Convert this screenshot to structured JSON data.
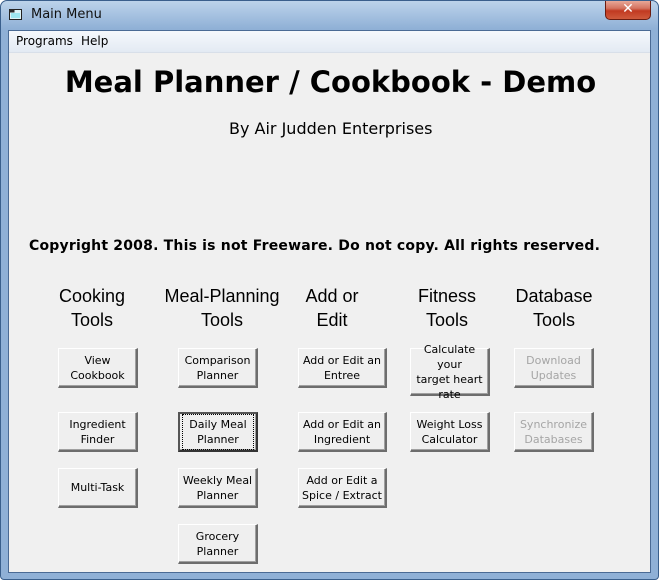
{
  "window": {
    "title": "Main Menu",
    "icon": "app-window-icon",
    "close_label": "✕"
  },
  "menubar": {
    "items": [
      {
        "label": "Programs"
      },
      {
        "label": "Help"
      }
    ]
  },
  "header": {
    "title": "Meal Planner / Cookbook - Demo",
    "subtitle": "By Air Judden Enterprises",
    "copyright": "Copyright 2008.  This is not Freeware.  Do not copy.  All rights reserved."
  },
  "columns": [
    {
      "header": "Cooking\nTools",
      "buttons": [
        {
          "label": "View\nCookbook",
          "enabled": true
        },
        {
          "label": "Ingredient\nFinder",
          "enabled": true
        },
        {
          "label": "Multi-Task",
          "enabled": true
        }
      ]
    },
    {
      "header": "Meal-Planning\nTools",
      "buttons": [
        {
          "label": "Comparison\nPlanner",
          "enabled": true
        },
        {
          "label": "Daily Meal\nPlanner",
          "enabled": true,
          "focused": true
        },
        {
          "label": "Weekly Meal\nPlanner",
          "enabled": true
        },
        {
          "label": "Grocery\nPlanner",
          "enabled": true
        }
      ]
    },
    {
      "header": "Add or\nEdit",
      "buttons": [
        {
          "label": "Add or Edit an\nEntree",
          "enabled": true
        },
        {
          "label": "Add or Edit an\nIngredient",
          "enabled": true
        },
        {
          "label": "Add or Edit a\nSpice / Extract",
          "enabled": true
        }
      ]
    },
    {
      "header": "Fitness\nTools",
      "buttons": [
        {
          "label": "Calculate your\ntarget heart\nrate",
          "enabled": true
        },
        {
          "label": "Weight Loss\nCalculator",
          "enabled": true
        }
      ]
    },
    {
      "header": "Database\nTools",
      "buttons": [
        {
          "label": "Download\nUpdates",
          "enabled": false
        },
        {
          "label": "Synchronize\nDatabases",
          "enabled": false
        }
      ]
    }
  ]
}
